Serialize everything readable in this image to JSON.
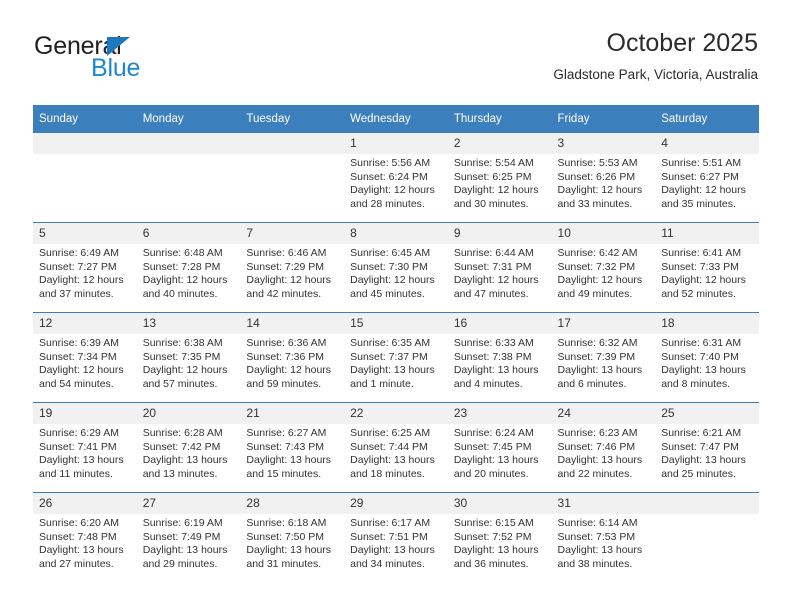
{
  "brand": {
    "name_top": "General",
    "name_bottom": "Blue",
    "triangle_icon": "triangle-icon",
    "color_dark": "#231f20",
    "color_blue": "#1f88d4"
  },
  "header": {
    "title": "October 2025",
    "subtitle": "Gladstone Park, Victoria, Australia"
  },
  "theme": {
    "header_blue": "#3c7fbd",
    "daybar_gray": "#f1f1f1",
    "text": "#333333"
  },
  "calendar": {
    "weekday_headers": [
      "Sunday",
      "Monday",
      "Tuesday",
      "Wednesday",
      "Thursday",
      "Friday",
      "Saturday"
    ],
    "weeks": [
      [
        {
          "day": "",
          "lines": []
        },
        {
          "day": "",
          "lines": []
        },
        {
          "day": "",
          "lines": []
        },
        {
          "day": "1",
          "lines": [
            "Sunrise: 5:56 AM",
            "Sunset: 6:24 PM",
            "Daylight: 12 hours and 28 minutes."
          ]
        },
        {
          "day": "2",
          "lines": [
            "Sunrise: 5:54 AM",
            "Sunset: 6:25 PM",
            "Daylight: 12 hours and 30 minutes."
          ]
        },
        {
          "day": "3",
          "lines": [
            "Sunrise: 5:53 AM",
            "Sunset: 6:26 PM",
            "Daylight: 12 hours and 33 minutes."
          ]
        },
        {
          "day": "4",
          "lines": [
            "Sunrise: 5:51 AM",
            "Sunset: 6:27 PM",
            "Daylight: 12 hours and 35 minutes."
          ]
        }
      ],
      [
        {
          "day": "5",
          "lines": [
            "Sunrise: 6:49 AM",
            "Sunset: 7:27 PM",
            "Daylight: 12 hours and 37 minutes."
          ]
        },
        {
          "day": "6",
          "lines": [
            "Sunrise: 6:48 AM",
            "Sunset: 7:28 PM",
            "Daylight: 12 hours and 40 minutes."
          ]
        },
        {
          "day": "7",
          "lines": [
            "Sunrise: 6:46 AM",
            "Sunset: 7:29 PM",
            "Daylight: 12 hours and 42 minutes."
          ]
        },
        {
          "day": "8",
          "lines": [
            "Sunrise: 6:45 AM",
            "Sunset: 7:30 PM",
            "Daylight: 12 hours and 45 minutes."
          ]
        },
        {
          "day": "9",
          "lines": [
            "Sunrise: 6:44 AM",
            "Sunset: 7:31 PM",
            "Daylight: 12 hours and 47 minutes."
          ]
        },
        {
          "day": "10",
          "lines": [
            "Sunrise: 6:42 AM",
            "Sunset: 7:32 PM",
            "Daylight: 12 hours and 49 minutes."
          ]
        },
        {
          "day": "11",
          "lines": [
            "Sunrise: 6:41 AM",
            "Sunset: 7:33 PM",
            "Daylight: 12 hours and 52 minutes."
          ]
        }
      ],
      [
        {
          "day": "12",
          "lines": [
            "Sunrise: 6:39 AM",
            "Sunset: 7:34 PM",
            "Daylight: 12 hours and 54 minutes."
          ]
        },
        {
          "day": "13",
          "lines": [
            "Sunrise: 6:38 AM",
            "Sunset: 7:35 PM",
            "Daylight: 12 hours and 57 minutes."
          ]
        },
        {
          "day": "14",
          "lines": [
            "Sunrise: 6:36 AM",
            "Sunset: 7:36 PM",
            "Daylight: 12 hours and 59 minutes."
          ]
        },
        {
          "day": "15",
          "lines": [
            "Sunrise: 6:35 AM",
            "Sunset: 7:37 PM",
            "Daylight: 13 hours and 1 minute."
          ]
        },
        {
          "day": "16",
          "lines": [
            "Sunrise: 6:33 AM",
            "Sunset: 7:38 PM",
            "Daylight: 13 hours and 4 minutes."
          ]
        },
        {
          "day": "17",
          "lines": [
            "Sunrise: 6:32 AM",
            "Sunset: 7:39 PM",
            "Daylight: 13 hours and 6 minutes."
          ]
        },
        {
          "day": "18",
          "lines": [
            "Sunrise: 6:31 AM",
            "Sunset: 7:40 PM",
            "Daylight: 13 hours and 8 minutes."
          ]
        }
      ],
      [
        {
          "day": "19",
          "lines": [
            "Sunrise: 6:29 AM",
            "Sunset: 7:41 PM",
            "Daylight: 13 hours and 11 minutes."
          ]
        },
        {
          "day": "20",
          "lines": [
            "Sunrise: 6:28 AM",
            "Sunset: 7:42 PM",
            "Daylight: 13 hours and 13 minutes."
          ]
        },
        {
          "day": "21",
          "lines": [
            "Sunrise: 6:27 AM",
            "Sunset: 7:43 PM",
            "Daylight: 13 hours and 15 minutes."
          ]
        },
        {
          "day": "22",
          "lines": [
            "Sunrise: 6:25 AM",
            "Sunset: 7:44 PM",
            "Daylight: 13 hours and 18 minutes."
          ]
        },
        {
          "day": "23",
          "lines": [
            "Sunrise: 6:24 AM",
            "Sunset: 7:45 PM",
            "Daylight: 13 hours and 20 minutes."
          ]
        },
        {
          "day": "24",
          "lines": [
            "Sunrise: 6:23 AM",
            "Sunset: 7:46 PM",
            "Daylight: 13 hours and 22 minutes."
          ]
        },
        {
          "day": "25",
          "lines": [
            "Sunrise: 6:21 AM",
            "Sunset: 7:47 PM",
            "Daylight: 13 hours and 25 minutes."
          ]
        }
      ],
      [
        {
          "day": "26",
          "lines": [
            "Sunrise: 6:20 AM",
            "Sunset: 7:48 PM",
            "Daylight: 13 hours and 27 minutes."
          ]
        },
        {
          "day": "27",
          "lines": [
            "Sunrise: 6:19 AM",
            "Sunset: 7:49 PM",
            "Daylight: 13 hours and 29 minutes."
          ]
        },
        {
          "day": "28",
          "lines": [
            "Sunrise: 6:18 AM",
            "Sunset: 7:50 PM",
            "Daylight: 13 hours and 31 minutes."
          ]
        },
        {
          "day": "29",
          "lines": [
            "Sunrise: 6:17 AM",
            "Sunset: 7:51 PM",
            "Daylight: 13 hours and 34 minutes."
          ]
        },
        {
          "day": "30",
          "lines": [
            "Sunrise: 6:15 AM",
            "Sunset: 7:52 PM",
            "Daylight: 13 hours and 36 minutes."
          ]
        },
        {
          "day": "31",
          "lines": [
            "Sunrise: 6:14 AM",
            "Sunset: 7:53 PM",
            "Daylight: 13 hours and 38 minutes."
          ]
        },
        {
          "day": "",
          "lines": []
        }
      ]
    ]
  }
}
